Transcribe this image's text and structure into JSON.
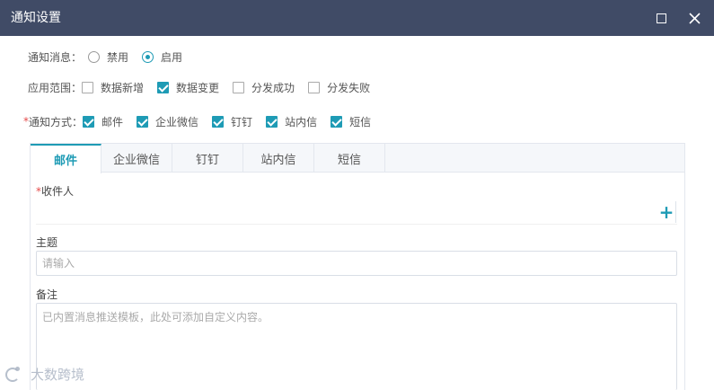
{
  "window": {
    "title": "通知设置",
    "maximize_icon": "maximize-icon",
    "close_icon": "close-icon"
  },
  "notify_msg": {
    "label": "通知消息：",
    "options": [
      {
        "label": "禁用",
        "selected": false
      },
      {
        "label": "启用",
        "selected": true
      }
    ]
  },
  "scope": {
    "label": "应用范围：",
    "options": [
      {
        "label": "数据新增",
        "checked": false
      },
      {
        "label": "数据变更",
        "checked": true
      },
      {
        "label": "分发成功",
        "checked": false
      },
      {
        "label": "分发失败",
        "checked": false
      }
    ]
  },
  "method": {
    "required_mark": "*",
    "label": "通知方式：",
    "options": [
      {
        "label": "邮件",
        "checked": true
      },
      {
        "label": "企业微信",
        "checked": true
      },
      {
        "label": "钉钉",
        "checked": true
      },
      {
        "label": "站内信",
        "checked": true
      },
      {
        "label": "短信",
        "checked": true
      }
    ]
  },
  "tabs": [
    {
      "label": "邮件",
      "active": true
    },
    {
      "label": "企业微信",
      "active": false
    },
    {
      "label": "钉钉",
      "active": false
    },
    {
      "label": "站内信",
      "active": false
    },
    {
      "label": "短信",
      "active": false
    }
  ],
  "form": {
    "recipient_required": "*",
    "recipient_label": "收件人",
    "add_label": "+",
    "subject_label": "主题",
    "subject_placeholder": "请输入",
    "remark_label": "备注",
    "remark_placeholder": "已内置消息推送模板，此处可添加自定义内容。"
  },
  "watermark": {
    "text": "大数跨境"
  },
  "colors": {
    "titlebar": "#404b66",
    "accent": "#1e9bb5",
    "required": "#e54b4b"
  }
}
